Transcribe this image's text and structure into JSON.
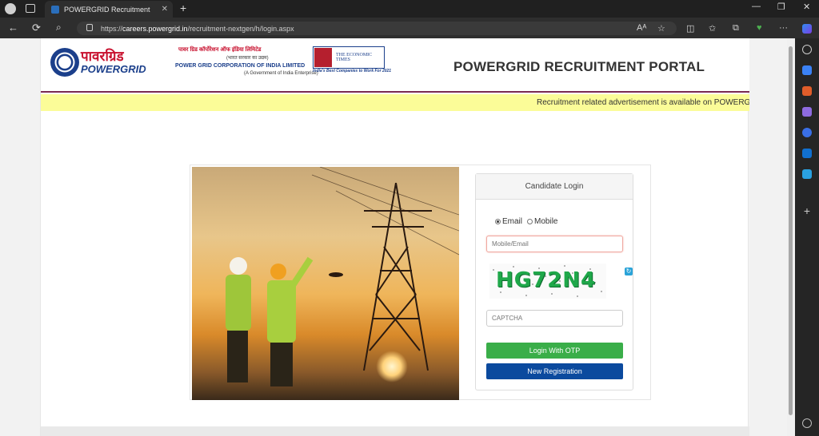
{
  "browser": {
    "tab_title": "POWERGRID Recruitment",
    "tab_close": "✕",
    "new_tab": "+",
    "url_scheme": "https://",
    "url_host": "careers.powergrid.in",
    "url_path": "/recruitment-nextgen/h/login.aspx",
    "min": "—",
    "max": "❐",
    "close": "✕",
    "back": "←",
    "reload": "⟳",
    "search": "⌕",
    "read_aloud": "Aᴬ",
    "favorite": "☆",
    "split": "◫",
    "favorites": "✩",
    "collections": "⧉",
    "health": "♥",
    "more": "···"
  },
  "header": {
    "logo_hindi": "पावरग्रिड",
    "logo_en": "POWERGRID",
    "corp_hindi": "पावर ग्रिड कॉर्पोरेशन ऑफ इंडिया लिमिटेड",
    "corp_sub": "(भारत सरकार का उद्यम)",
    "corp_en": "POWER GRID CORPORATION OF INDIA LIMITED",
    "corp_gov": "(A Government of India Enterprise)",
    "award_title": "THE ECONOMIC TIMES",
    "award_sub": "India's Best Companies to Work For 2021",
    "portal_title": "POWERGRID RECRUITMENT PORTAL"
  },
  "marquee": {
    "text": "Recruitment related advertisement is available on POWERG"
  },
  "login": {
    "heading": "Candidate Login",
    "radio_email": "Email",
    "radio_mobile": "Mobile",
    "selected": "Email",
    "id_placeholder": "Mobile/Email",
    "captcha_text": "HG72N4",
    "captcha_placeholder": "CAPTCHA",
    "otp_button": "Login With OTP",
    "register_button": "New Registration"
  },
  "colors": {
    "otp": "#3aae49",
    "register": "#0b4a9e",
    "marquee_bg": "#fbfc98",
    "brand_red": "#c8102e",
    "brand_blue": "#1b3f8b"
  }
}
